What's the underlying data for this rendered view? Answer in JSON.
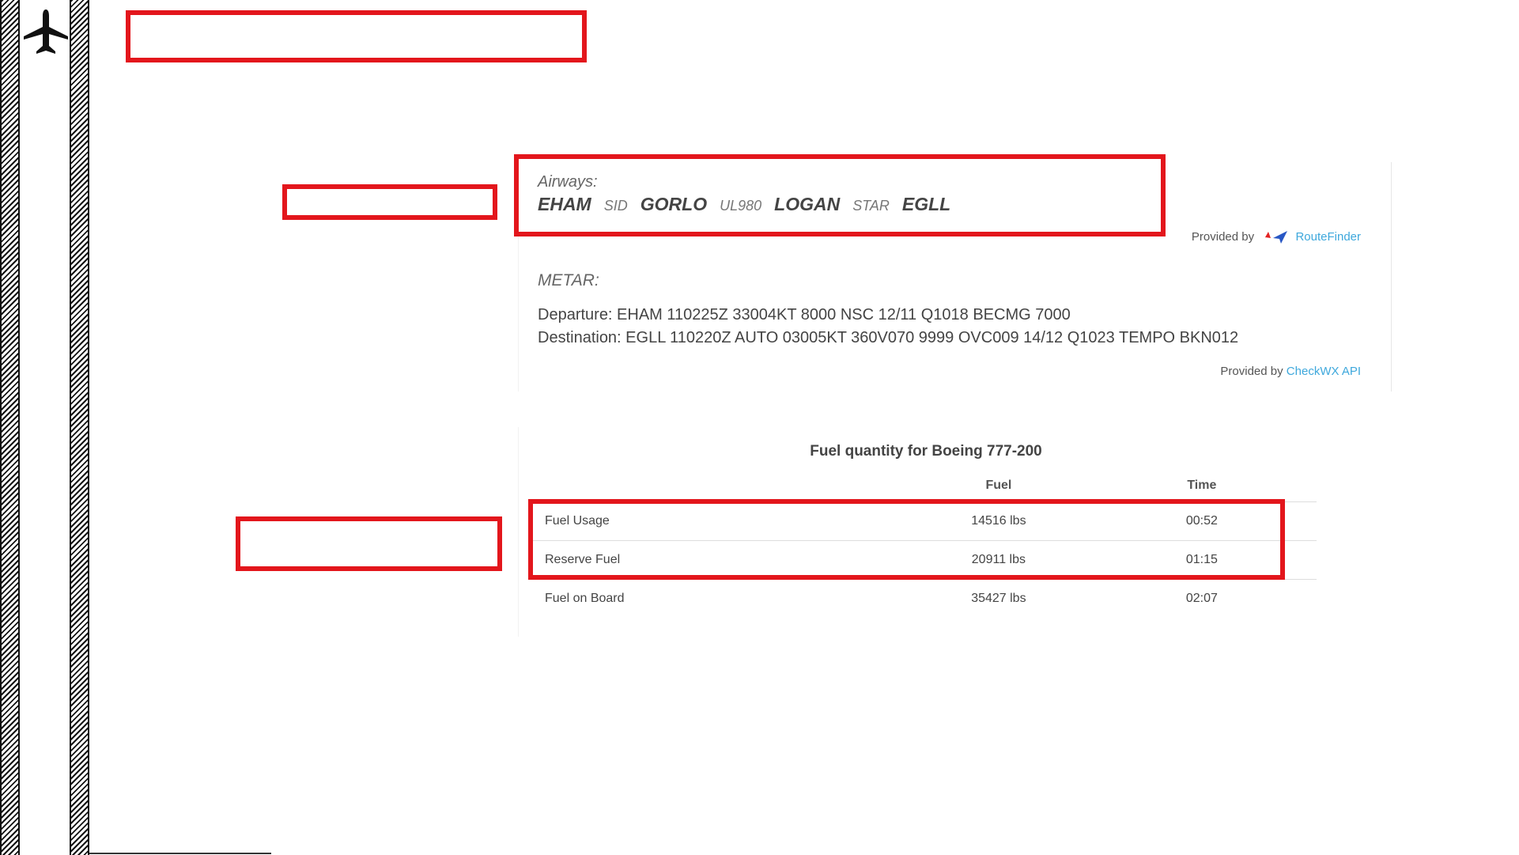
{
  "route": {
    "airways_label": "Airways:",
    "waypoints": {
      "departure": "EHAM",
      "sid": "SID",
      "fix1": "GORLO",
      "airway": "UL980",
      "fix2": "LOGAN",
      "star": "STAR",
      "destination": "EGLL"
    },
    "provided_by_label": "Provided by",
    "provider_name": "RouteFinder"
  },
  "metar": {
    "label": "METAR:",
    "departure": "Departure: EHAM 110225Z 33004KT 8000 NSC 12/11 Q1018 BECMG 7000",
    "destination": "Destination: EGLL 110220Z AUTO 03005KT 360V070 9999 OVC009 14/12 Q1023 TEMPO BKN012",
    "provided_by_label": "Provided by",
    "provider_name": "CheckWX API"
  },
  "fuel": {
    "title": "Fuel quantity for Boeing 777-200",
    "headers": [
      "",
      "Fuel",
      "Time"
    ],
    "rows": [
      {
        "label": "Fuel Usage",
        "fuel": "14516 lbs",
        "time": "00:52"
      },
      {
        "label": "Reserve Fuel",
        "fuel": "20911 lbs",
        "time": "01:15"
      },
      {
        "label": "Fuel on Board",
        "fuel": "35427 lbs",
        "time": "02:07"
      }
    ]
  },
  "colors": {
    "annotation_red": "#e3161c",
    "link_blue": "#3ea8dc",
    "text": "#444444"
  },
  "icons": {
    "sidebar": "airplane-icon",
    "route_provider": "routefinder-logo-icon"
  }
}
